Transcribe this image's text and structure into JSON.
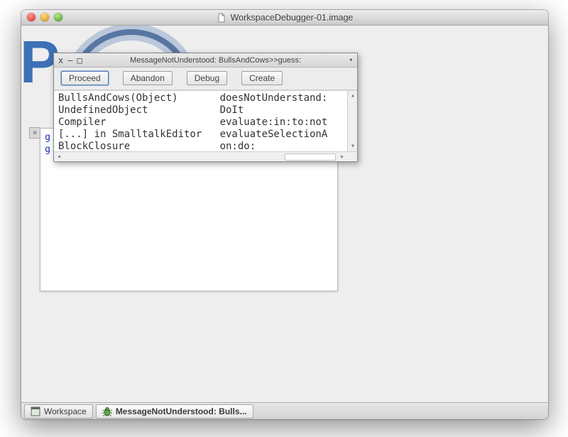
{
  "window": {
    "title": "WorkspaceDebugger-01.image"
  },
  "workspace": {
    "close_glyph": "×",
    "line1_prefix": "g",
    "line2_prefix": "g",
    "line2_selected": ""
  },
  "debugger": {
    "title": "MessageNotUnderstood: BullsAndCows>>guess:",
    "close_glyph": "x",
    "min_glyph": "–",
    "max_glyph": "□",
    "menu_glyph": "▾",
    "buttons": {
      "proceed": "Proceed",
      "abandon": "Abandon",
      "debug": "Debug",
      "create": "Create"
    },
    "stack": [
      {
        "receiver": "BullsAndCows(Object)",
        "selector": "doesNotUnderstand:"
      },
      {
        "receiver": "UndefinedObject",
        "selector": "DoIt"
      },
      {
        "receiver": "Compiler",
        "selector": "evaluate:in:to:not"
      },
      {
        "receiver": "[...] in SmalltalkEditor",
        "selector": "evaluateSelectionA"
      },
      {
        "receiver": "BlockClosure",
        "selector": "on:do:"
      }
    ],
    "scroll": {
      "up": "▴",
      "down": "▾",
      "left": "◂",
      "right": "▸"
    }
  },
  "taskbar": {
    "items": [
      {
        "label": "Workspace",
        "active": false
      },
      {
        "label": "MessageNotUnderstood: Bulls...",
        "active": true
      }
    ]
  }
}
